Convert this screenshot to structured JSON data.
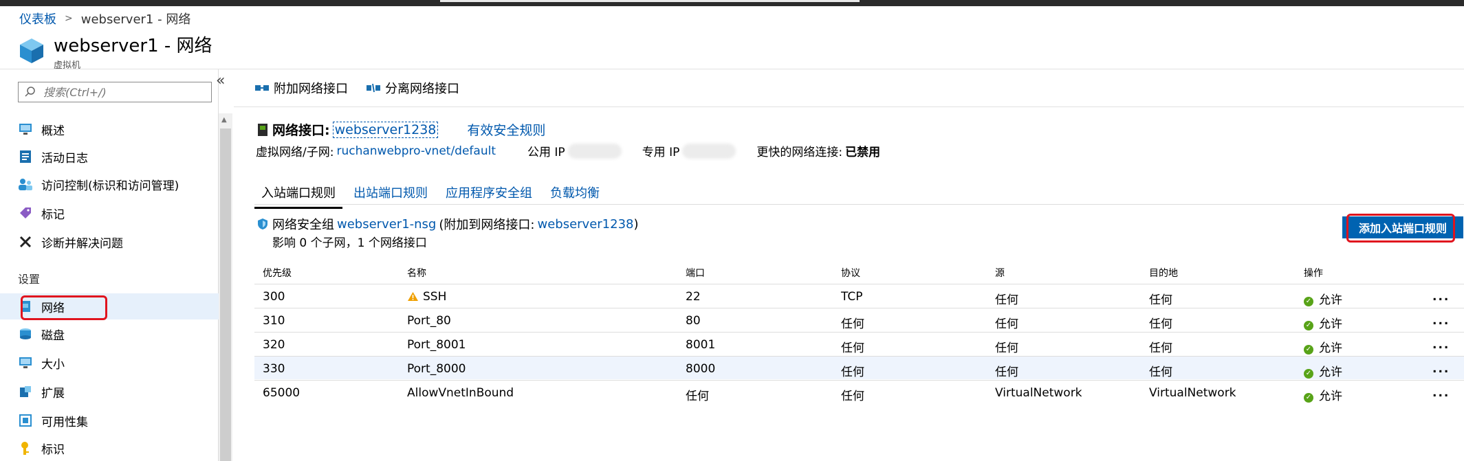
{
  "breadcrumb": {
    "root": "仪表板",
    "separator": ">",
    "current": "webserver1 - 网络"
  },
  "header": {
    "title": "webserver1 - 网络",
    "subtitle": "虚拟机"
  },
  "sidebar": {
    "search_placeholder": "搜索(Ctrl+/)",
    "collapse_glyph": "«",
    "items": [
      {
        "label": "概述",
        "icon": "overview-icon"
      },
      {
        "label": "活动日志",
        "icon": "activity-log-icon"
      },
      {
        "label": "访问控制(标识和访问管理)",
        "icon": "access-control-icon"
      },
      {
        "label": "标记",
        "icon": "tag-icon"
      },
      {
        "label": "诊断并解决问题",
        "icon": "wrench-icon"
      }
    ],
    "section_settings": "设置",
    "settings_items": [
      {
        "label": "网络",
        "icon": "network-icon",
        "active": true
      },
      {
        "label": "磁盘",
        "icon": "disk-icon"
      },
      {
        "label": "大小",
        "icon": "size-icon"
      },
      {
        "label": "扩展",
        "icon": "extension-icon"
      },
      {
        "label": "可用性集",
        "icon": "availability-set-icon"
      },
      {
        "label": "标识",
        "icon": "identity-icon"
      }
    ]
  },
  "toolbar": {
    "attach_label": "附加网络接口",
    "detach_label": "分离网络接口"
  },
  "nic": {
    "label": "网络接口:",
    "name": "webserver1238",
    "effective_rules": "有效安全规则",
    "vnet_label": "虚拟网络/子网:",
    "vnet_value": "ruchanwebpro-vnet/default",
    "public_ip_label": "公用 IP",
    "private_ip_label": "专用 IP",
    "accel_label": "更快的网络连接:",
    "accel_value": "已禁用"
  },
  "tabs": [
    "入站端口规则",
    "出站端口规则",
    "应用程序安全组",
    "负载均衡"
  ],
  "nsg": {
    "prefix": "网络安全组",
    "name": "webserver1-nsg",
    "attached_prefix": "(附加到网络接口:",
    "attached_nic": "webserver1238",
    "attached_suffix": ")",
    "impact": "影响 0 个子网，1 个网络接口",
    "add_button": "添加入站端口规则"
  },
  "table": {
    "headers": [
      "优先级",
      "名称",
      "端口",
      "协议",
      "源",
      "目的地",
      "操作"
    ],
    "rows": [
      {
        "priority": "300",
        "name": "SSH",
        "warn": true,
        "port": "22",
        "protocol": "TCP",
        "source": "任何",
        "dest": "任何",
        "action": "允许"
      },
      {
        "priority": "310",
        "name": "Port_80",
        "port": "80",
        "protocol": "任何",
        "source": "任何",
        "dest": "任何",
        "action": "允许"
      },
      {
        "priority": "320",
        "name": "Port_8001",
        "port": "8001",
        "protocol": "任何",
        "source": "任何",
        "dest": "任何",
        "action": "允许"
      },
      {
        "priority": "330",
        "name": "Port_8000",
        "port": "8000",
        "protocol": "任何",
        "source": "任何",
        "dest": "任何",
        "action": "允许"
      },
      {
        "priority": "65000",
        "name": "AllowVnetInBound",
        "port": "任何",
        "protocol": "任何",
        "source": "VirtualNetwork",
        "dest": "VirtualNetwork",
        "action": "允许"
      }
    ],
    "more_glyph": "..."
  },
  "colors": {
    "link": "#0058ad",
    "accent": "#0063b1",
    "highlight_box": "#e0141e",
    "allow_green": "#58a318"
  }
}
